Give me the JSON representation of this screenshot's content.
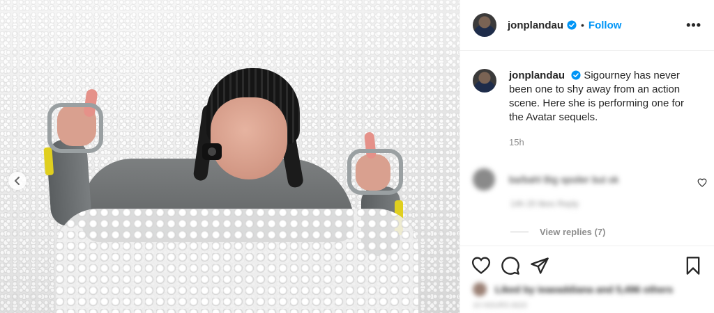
{
  "post": {
    "username": "jonplandau",
    "follow_label": "Follow",
    "separator": "•",
    "more_label": "•••",
    "caption": "Sigourney has never been one to shy away from an action scene. Here she is performing one for the Avatar sequels.",
    "time_ago": "15h",
    "verified_color": "#0095f6",
    "accent_color": "#0095f6"
  },
  "comment": {
    "text": "ba/bahl Big spoiler but ok",
    "meta": "14h   20 likes   Reply",
    "view_replies": "View replies (7)"
  },
  "likes": {
    "text": "Liked by ieaeaddiana and 5,496 others"
  },
  "date": {
    "text": "10 HOURS AGO"
  },
  "icons": {
    "prev": "chevron-left-icon",
    "like": "heart-icon",
    "comment": "comment-icon",
    "share": "paper-plane-icon",
    "save": "bookmark-icon",
    "comment_like": "heart-icon",
    "verified": "verified-badge-icon",
    "more": "more-horizontal-icon"
  }
}
